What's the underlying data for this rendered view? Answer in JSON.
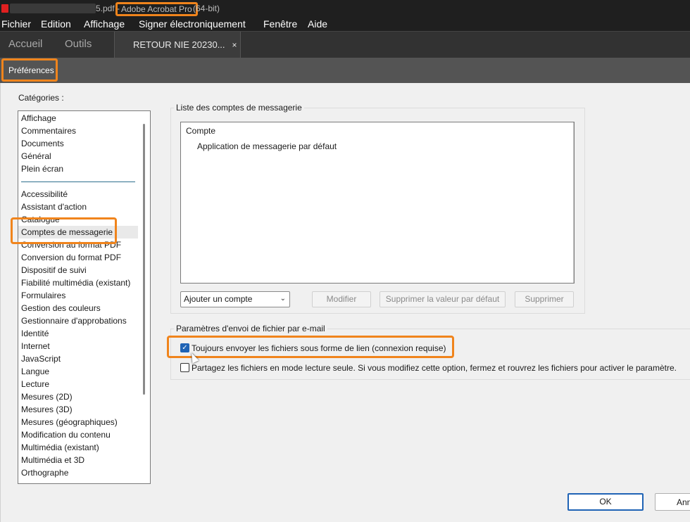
{
  "titlebar": {
    "file_suffix": "5.pdf -",
    "app_name": "Adobe Acrobat Pro",
    "bits": "(64-bit)"
  },
  "menu": [
    "Fichier",
    "Edition",
    "Affichage",
    "Signer électroniquement",
    "Fenêtre",
    "Aide"
  ],
  "tabs": {
    "home": "Accueil",
    "tools": "Outils",
    "document": "RETOUR NIE 20230...",
    "close": "×"
  },
  "dialog": {
    "title": "Préférences",
    "categories_label": "Catégories :",
    "categories_top": [
      "Affichage",
      "Commentaires",
      "Documents",
      "Général",
      "Plein écran"
    ],
    "categories": [
      "Accessibilité",
      "Assistant d'action",
      "Catalogue",
      "Comptes de messagerie",
      "Conversion au format PDF",
      "Conversion du format PDF",
      "Dispositif de suivi",
      "Fiabilité multimédia (existant)",
      "Formulaires",
      "Gestion des couleurs",
      "Gestionnaire d'approbations",
      "Identité",
      "Internet",
      "JavaScript",
      "Langue",
      "Lecture",
      "Mesures (2D)",
      "Mesures (3D)",
      "Mesures (géographiques)",
      "Modification du contenu",
      "Multimédia (existant)",
      "Multimédia et 3D",
      "Orthographe"
    ],
    "selected_category": "Comptes de messagerie",
    "accounts_group_title": "Liste des comptes de messagerie",
    "accounts_header": "Compte",
    "accounts_rows": [
      "Application de messagerie par défaut"
    ],
    "add_account": "Ajouter un compte",
    "buttons": {
      "modify": "Modifier",
      "remove_default": "Supprimer la valeur par défaut",
      "delete": "Supprimer"
    },
    "send_group_title": "Paramètres d'envoi de fichier par e-mail",
    "option_link": "Toujours envoyer les fichiers sous forme de lien (connexion requise)",
    "option_link_checked": true,
    "option_readonly": "Partagez les fichiers en mode lecture seule. Si vous modifiez cette option, fermez et rouvrez les fichiers pour activer le paramètre.",
    "option_readonly_checked": false,
    "ok": "OK",
    "cancel": "Annuler"
  },
  "colors": {
    "highlight": "#f0841c",
    "accent": "#1f63b5"
  }
}
